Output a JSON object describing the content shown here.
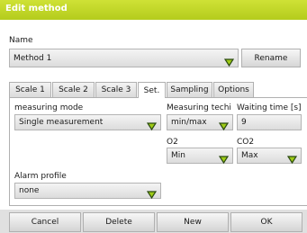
{
  "window": {
    "title": "Edit method"
  },
  "name_section": {
    "label": "Name",
    "value": "Method 1",
    "rename_label": "Rename"
  },
  "tabs": [
    {
      "label": "Scale 1",
      "active": false
    },
    {
      "label": "Scale 2",
      "active": false
    },
    {
      "label": "Scale 3",
      "active": false
    },
    {
      "label": "Set.",
      "active": true
    },
    {
      "label": "Sampling",
      "active": false
    },
    {
      "label": "Options",
      "active": false
    }
  ],
  "settings": {
    "measuring_mode": {
      "label": "measuring mode",
      "value": "Single measurement"
    },
    "measuring_technique": {
      "label": "Measuring techi",
      "value": "min/max"
    },
    "waiting_time": {
      "label": "Waiting time [s]",
      "value": "9"
    },
    "o2": {
      "label": "O2",
      "value": "Min"
    },
    "co2": {
      "label": "CO2",
      "value": "Max"
    },
    "alarm_profile": {
      "label": "Alarm profile",
      "value": "none"
    }
  },
  "footer": {
    "cancel_label": "Cancel",
    "delete_label": "Delete",
    "new_label": "New",
    "ok_label": "OK"
  },
  "colors": {
    "title_bar": "#c2d82a",
    "dropdown_arrow_fill": "#9ecb16",
    "dropdown_arrow_stroke": "#2a4a10"
  },
  "icons": {
    "dropdown": "chevron-down-icon"
  }
}
